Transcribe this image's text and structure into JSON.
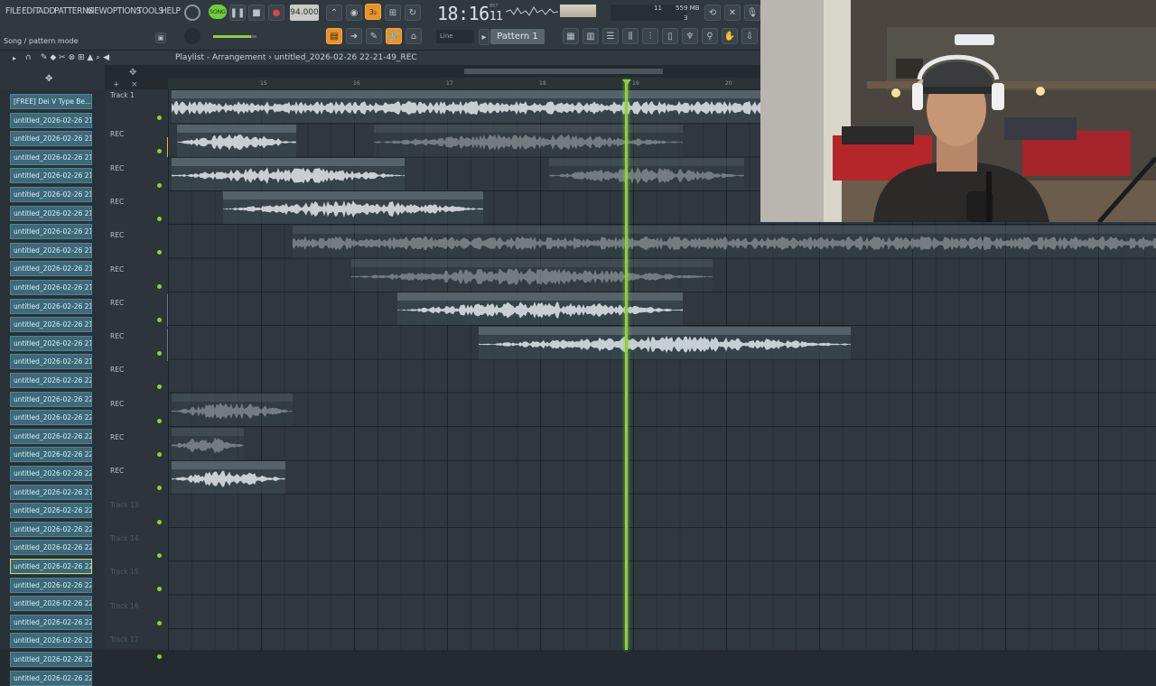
{
  "menu": [
    "FILE",
    "EDIT",
    "ADD",
    "PATTERNS",
    "VIEW",
    "OPTIONS",
    "TOOLS",
    "HELP"
  ],
  "transport": {
    "bpm": "94.000",
    "time_main": "18:16",
    "time_sub": "11",
    "time_tiny": "857",
    "song_mode_label": "SONG"
  },
  "status": {
    "hint": "Song / pattern mode",
    "memory": "559 MB",
    "poly": "11",
    "poly2": "3"
  },
  "pattern_selector": "Pattern 1",
  "snap_selector": "Line",
  "playlist": {
    "title": "Playlist - Arrangement",
    "arrangement": "untitled_2026-02-26 22-21-49_REC"
  },
  "ruler": [
    "15",
    "16",
    "17",
    "18",
    "19",
    "20"
  ],
  "browser_items": [
    "[FREE] Dei V Type Be...",
    "untitled_2026-02-26 21-...",
    "untitled_2026-02-26 21-...",
    "untitled_2026-02-26 21-...",
    "untitled_2026-02-26 21-...",
    "untitled_2026-02-26 21-...",
    "untitled_2026-02-26 21-...",
    "untitled_2026-02-26 21-...",
    "untitled_2026-02-26 21-...",
    "untitled_2026-02-26 21-...",
    "untitled_2026-02-26 21-...",
    "untitled_2026-02-26 21-...",
    "untitled_2026-02-26 21-...",
    "untitled_2026-02-26 21-...",
    "untitled_2026-02-26 21-...",
    "untitled_2026-02-26 22-...",
    "untitled_2026-02-26 22-...",
    "untitled_2026-02-26 22-...",
    "untitled_2026-02-26 22-...",
    "untitled_2026-02-26 22-...",
    "untitled_2026-02-26 22-...",
    "untitled_2026-02-26 27-...",
    "untitled_2026-02-26 22-...",
    "untitled_2026-02-26 22-...",
    "untitled_2026-02-26 22-...",
    "untitled_2026-02-26 22-...",
    "untitled_2026-02-26 22-...",
    "untitled_2026-02-26 22-...",
    "untitled_2026-02-26 22-...",
    "untitled_2026-02-26 22-...",
    "untitled_2026-02-26 22-...",
    "untitled_2026-02-26 22-..."
  ],
  "tracks": [
    {
      "label": "Track 1"
    },
    {
      "label": "REC"
    },
    {
      "label": "REC"
    },
    {
      "label": "REC"
    },
    {
      "label": "REC"
    },
    {
      "label": "REC"
    },
    {
      "label": "REC"
    },
    {
      "label": "REC"
    },
    {
      "label": "REC"
    },
    {
      "label": "REC"
    },
    {
      "label": "REC"
    },
    {
      "label": "REC"
    },
    {
      "label": "Track 13"
    },
    {
      "label": "Track 14"
    },
    {
      "label": "Track 15"
    },
    {
      "label": "Track 16"
    },
    {
      "label": "Track 17"
    }
  ],
  "clips": [
    {
      "name": "[FREE] Dei V Type Beat CLIMA  Trap Instrumental",
      "muted": false
    },
    {
      "name": "untitled_2026-02-26 22-21-49_REC",
      "muted": false
    },
    {
      "name": "untitled_2026-02-27 00-24-12_REC",
      "muted": true
    },
    {
      "name": "untitled_2026-02-26 22-23-11_REC",
      "muted": false
    },
    {
      "name": "untitled_2026-02-27 00-25-49_REC",
      "muted": true
    },
    {
      "name": "untitled_2026-02-26 22-24-36_REC",
      "muted": false
    },
    {
      "name": "untitled_2026-02-26 22-26-42_REC",
      "muted": true
    },
    {
      "name": "untitled_2026-02-27 00-24-42_REC",
      "muted": true
    },
    {
      "name": "untitled_2026-02-27 00-25-03_REC",
      "muted": false
    },
    {
      "name": "untitled_2026-02-27 00-26-21_REC",
      "muted": false
    },
    {
      "name": "untitled_2026-02-26 22-18-30_REC",
      "muted": true
    },
    {
      "name": "untitled_2-20-07_REC",
      "muted": true
    },
    {
      "name": "untitled_2026-02-27 00-23-02_REC",
      "muted": false
    }
  ],
  "colors": {
    "accent_orange": "#e99325",
    "playhead_green": "#8ad13e",
    "browser_item": "#3b6a7a",
    "clip_header": "#56626a"
  }
}
